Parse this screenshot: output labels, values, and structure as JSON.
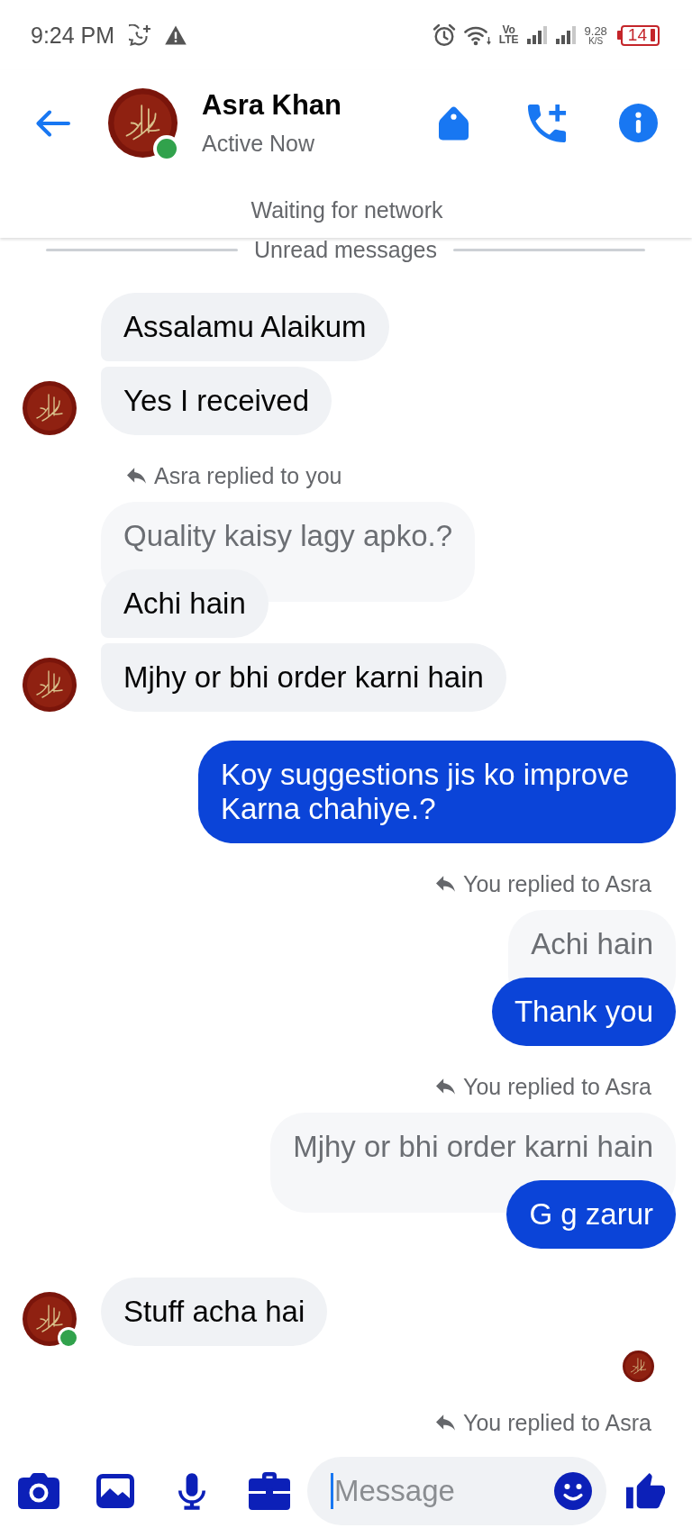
{
  "status_bar": {
    "time": "9:24 PM",
    "volte": {
      "top": "Vo",
      "bottom": "LTE"
    },
    "speed": {
      "value": "9.28",
      "unit": "K/S"
    },
    "battery": "14"
  },
  "header": {
    "name": "Asra Khan",
    "status": "Active Now",
    "online": true,
    "network_notice": "Waiting for network"
  },
  "unread_divider": "Unread messages",
  "messages": [
    {
      "kind": "bubble",
      "outgoing": false,
      "text": "Assalamu Alaikum",
      "avatar": false
    },
    {
      "kind": "bubble",
      "outgoing": false,
      "text": "Yes I received",
      "avatar": true,
      "online": false
    },
    {
      "kind": "reply_note",
      "outgoing": false,
      "text": "Asra replied to you"
    },
    {
      "kind": "reply",
      "outgoing": false,
      "quote": "Quality kaisy lagy apko.?",
      "text": "Achi hain",
      "avatar": false
    },
    {
      "kind": "bubble",
      "outgoing": false,
      "text": "Mjhy or bhi order karni hain",
      "avatar": true,
      "online": false
    },
    {
      "kind": "bubble",
      "outgoing": true,
      "text": "Koy suggestions jis ko improve Karna chahiye.?"
    },
    {
      "kind": "reply_note",
      "outgoing": true,
      "text": "You replied to Asra"
    },
    {
      "kind": "reply",
      "outgoing": true,
      "quote": "Achi hain",
      "text": "Thank you"
    },
    {
      "kind": "reply_note",
      "outgoing": true,
      "text": "You replied to Asra"
    },
    {
      "kind": "reply",
      "outgoing": true,
      "quote": "Mjhy or bhi order karni hain",
      "text": "G g zarur"
    },
    {
      "kind": "bubble",
      "outgoing": false,
      "text": "Stuff acha hai",
      "avatar": true,
      "online": true
    },
    {
      "kind": "seen"
    },
    {
      "kind": "reply_note",
      "outgoing": true,
      "text": "You replied to Asra"
    }
  ],
  "composer": {
    "placeholder": "Message"
  }
}
